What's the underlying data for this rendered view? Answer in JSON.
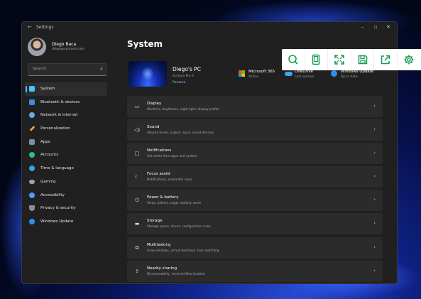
{
  "window": {
    "title": "Settings"
  },
  "profile": {
    "name": "Diego Baca",
    "email": "diego@contoso.com"
  },
  "search": {
    "placeholder": "Search"
  },
  "nav": {
    "items": [
      {
        "label": "System",
        "icon": "monitor-icon",
        "color": "#4cc2ff",
        "active": true
      },
      {
        "label": "Bluetooth & devices",
        "icon": "bluetooth-icon",
        "color": "#3a8dde"
      },
      {
        "label": "Network & internet",
        "icon": "wifi-icon",
        "color": "#6aa9e8"
      },
      {
        "label": "Personalization",
        "icon": "brush-icon",
        "color": "#e8a03a"
      },
      {
        "label": "Apps",
        "icon": "apps-icon",
        "color": "#7c8fa8"
      },
      {
        "label": "Accounts",
        "icon": "person-icon",
        "color": "#2fbf7f"
      },
      {
        "label": "Time & language",
        "icon": "globe-clock-icon",
        "color": "#3aa0e8"
      },
      {
        "label": "Gaming",
        "icon": "controller-icon",
        "color": "#9aa3ad"
      },
      {
        "label": "Accessibility",
        "icon": "accessibility-icon",
        "color": "#4a9cff"
      },
      {
        "label": "Privacy & security",
        "icon": "shield-icon",
        "color": "#8a8f99"
      },
      {
        "label": "Windows Update",
        "icon": "update-icon",
        "color": "#2f8ff0"
      }
    ]
  },
  "main": {
    "title": "System",
    "device": {
      "name": "Diego's PC",
      "model": "Surface Pro X",
      "rename": "Rename"
    },
    "tiles": [
      {
        "title": "Microsoft 365",
        "subtitle": "Active",
        "icon": "microsoft-logo-icon"
      },
      {
        "title": "OneDrive",
        "subtitle": "Last synced",
        "icon": "cloud-icon"
      },
      {
        "title": "Windows Update",
        "subtitle": "Up to date",
        "icon": "update-icon"
      }
    ],
    "rows": [
      {
        "title": "Display",
        "subtitle": "Monitors, brightness, night light, display profile",
        "icon": "display-icon"
      },
      {
        "title": "Sound",
        "subtitle": "Volume levels, output, input, sound devices",
        "icon": "speaker-icon"
      },
      {
        "title": "Notifications",
        "subtitle": "Get alerts from apps and system",
        "icon": "notification-icon"
      },
      {
        "title": "Focus assist",
        "subtitle": "Notifications, automatic rules",
        "icon": "moon-icon"
      },
      {
        "title": "Power & battery",
        "subtitle": "Sleep, battery usage, battery saver",
        "icon": "power-icon"
      },
      {
        "title": "Storage",
        "subtitle": "Storage space, drives, configuration rules",
        "icon": "storage-icon"
      },
      {
        "title": "Multitasking",
        "subtitle": "Snap windows, virtual desktops, task switching",
        "icon": "multitasking-icon"
      },
      {
        "title": "Nearby sharing",
        "subtitle": "Discoverability, received files location",
        "icon": "share-icon"
      }
    ]
  },
  "toolbar": {
    "accent": "#1a9b55",
    "buttons": [
      {
        "name": "zoom-search-icon"
      },
      {
        "name": "device-frame-icon"
      },
      {
        "name": "fullscreen-icon"
      },
      {
        "name": "save-icon"
      },
      {
        "name": "export-icon"
      },
      {
        "name": "gear-icon"
      }
    ]
  }
}
